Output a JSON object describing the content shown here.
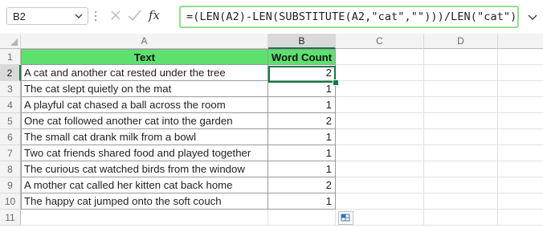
{
  "name_box": {
    "value": "B2"
  },
  "formula_bar": {
    "cancel_icon": "close-icon",
    "enter_icon": "checkmark-icon",
    "function_label": "fx",
    "formula": "=(LEN(A2)-LEN(SUBSTITUTE(A2,\"cat\",\"\")))/LEN(\"cat\")"
  },
  "columns": [
    "A",
    "B",
    "C",
    "D"
  ],
  "selected_column": "B",
  "selected_row": "2",
  "rows": [
    "1",
    "2",
    "3",
    "4",
    "5",
    "6",
    "7",
    "8",
    "9",
    "10",
    "11"
  ],
  "table": {
    "headers": {
      "text": "Text",
      "count": "Word Count"
    },
    "header_fill": "#5ee06f",
    "data": [
      {
        "text": "A cat and another cat rested under the tree",
        "count": "2"
      },
      {
        "text": "The cat slept quietly on the mat",
        "count": "1"
      },
      {
        "text": "A playful cat chased a ball across the room",
        "count": "1"
      },
      {
        "text": "One cat followed another cat into the garden",
        "count": "2"
      },
      {
        "text": "The small cat drank milk from a bowl",
        "count": "1"
      },
      {
        "text": "Two cat friends shared food and played together",
        "count": "1"
      },
      {
        "text": "The curious cat watched birds from the window",
        "count": "1"
      },
      {
        "text": "A mother cat called her kitten cat back home",
        "count": "2"
      },
      {
        "text": "The happy cat jumped onto the soft couch",
        "count": "1"
      }
    ]
  },
  "accent_color": "#107c41"
}
